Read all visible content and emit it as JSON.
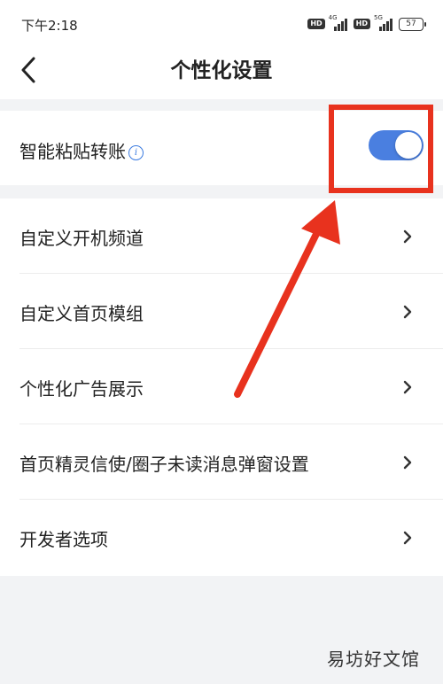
{
  "status_bar": {
    "time": "下午2:18",
    "hd_badge": "HD",
    "network_1": "4G",
    "network_2": "5G",
    "battery": "57"
  },
  "header": {
    "title": "个性化设置",
    "back_icon": "chevron-left-icon"
  },
  "toggle_row": {
    "label": "智能粘贴转账",
    "info_icon": "i",
    "enabled": true,
    "accent_color": "#4a7fe0"
  },
  "settings_items": [
    {
      "label": "自定义开机频道"
    },
    {
      "label": "自定义首页模组"
    },
    {
      "label": "个性化广告展示"
    },
    {
      "label": "首页精灵信使/圈子未读消息弹窗设置"
    },
    {
      "label": "开发者选项"
    }
  ],
  "annotation_color": "#e8321e",
  "watermark": "易坊好文馆"
}
